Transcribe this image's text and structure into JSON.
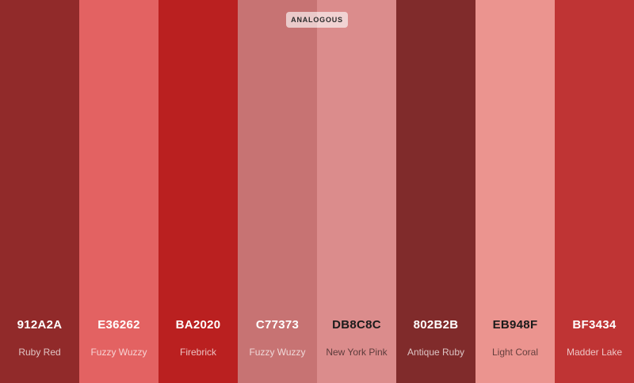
{
  "badge": "ANALOGOUS",
  "colors": [
    {
      "hex": "912A2A",
      "name": "Ruby Red",
      "color": "#912A2A",
      "text_tone": "light"
    },
    {
      "hex": "E36262",
      "name": "Fuzzy Wuzzy",
      "color": "#E36262",
      "text_tone": "light"
    },
    {
      "hex": "BA2020",
      "name": "Firebrick",
      "color": "#BA2020",
      "text_tone": "light"
    },
    {
      "hex": "C77373",
      "name": "Fuzzy Wuzzy",
      "color": "#C77373",
      "text_tone": "light"
    },
    {
      "hex": "DB8C8C",
      "name": "New York Pink",
      "color": "#DB8C8C",
      "text_tone": "dark"
    },
    {
      "hex": "802B2B",
      "name": "Antique Ruby",
      "color": "#802B2B",
      "text_tone": "light"
    },
    {
      "hex": "EB948F",
      "name": "Light Coral",
      "color": "#EB948F",
      "text_tone": "dark"
    },
    {
      "hex": "BF3434",
      "name": "Madder Lake",
      "color": "#BF3434",
      "text_tone": "light"
    }
  ]
}
